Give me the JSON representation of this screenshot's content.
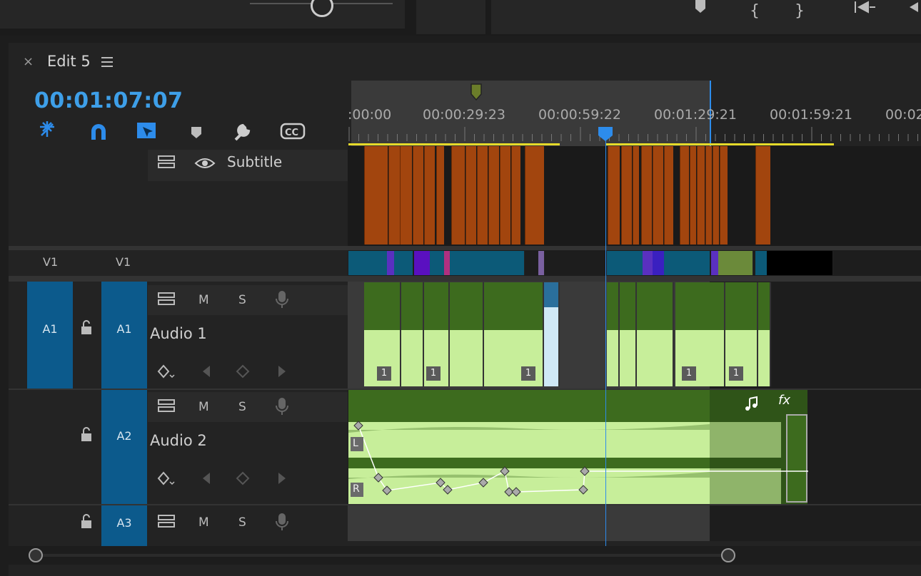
{
  "sequence": {
    "tab_title": "Edit 5",
    "timecode": "00:01:07:07"
  },
  "ruler": {
    "labels": [
      ":00:00",
      "00:00:29:23",
      "00:00:59:22",
      "00:01:29:21",
      "00:01:59:21",
      "00:02"
    ]
  },
  "tracks": {
    "subtitle": {
      "label": "Subtitle"
    },
    "v1": {
      "source": "V1",
      "target": "V1"
    },
    "a1": {
      "source": "A1",
      "target": "A1",
      "name": "Audio 1",
      "mute": "M",
      "solo": "S"
    },
    "a2": {
      "target": "A2",
      "name": "Audio 2",
      "mute": "M",
      "solo": "S"
    },
    "a3": {
      "target": "A3",
      "mute": "M",
      "solo": "S"
    }
  },
  "clips": {
    "a1_label": "1",
    "a2_left": "L",
    "a2_right": "R",
    "fx_label": "fx"
  },
  "colors": {
    "accent_blue": "#2d8ceb",
    "caption_orange": "#a2450e",
    "audio_green": "#3d6b1e",
    "waveform_green": "#c7ee9a",
    "track_target_blue": "#0c5a8c",
    "work_area_yellow": "#e6db2a"
  }
}
